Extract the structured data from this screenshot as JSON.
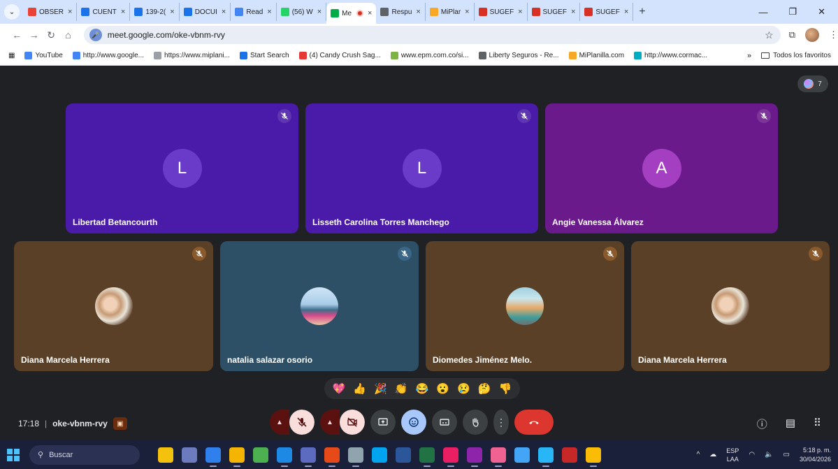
{
  "browser": {
    "tabs": [
      {
        "label": "OBSER",
        "favicon_color": "#ea4335"
      },
      {
        "label": "CUENT",
        "favicon_color": "#1a73e8"
      },
      {
        "label": "139-2(",
        "favicon_color": "#1a73e8"
      },
      {
        "label": "DOCUI",
        "favicon_color": "#1a73e8"
      },
      {
        "label": "Read",
        "favicon_color": "#4285f4"
      },
      {
        "label": "(56) W",
        "favicon_color": "#25d366"
      },
      {
        "label": "Me",
        "favicon_color": "#00ac47",
        "active": true
      },
      {
        "label": "Respu",
        "favicon_color": "#5f6368"
      },
      {
        "label": "MiPlar",
        "favicon_color": "#f9a825"
      },
      {
        "label": "SUGEF",
        "favicon_color": "#d93025"
      },
      {
        "label": "SUGEF",
        "favicon_color": "#d93025"
      },
      {
        "label": "SUGEF",
        "favicon_color": "#d93025"
      }
    ],
    "new_tab": "+",
    "close_glyph": "×",
    "url": "meet.google.com/oke-vbnm-rvy",
    "bookmarks": [
      {
        "label": "YouTube",
        "favicon_color": "#4285f4"
      },
      {
        "label": "http://www.google...",
        "favicon_color": "#4285f4"
      },
      {
        "label": "https://www.miplani...",
        "favicon_color": "#9aa0a6"
      },
      {
        "label": "Start Search",
        "favicon_color": "#1a73e8"
      },
      {
        "label": "(4) Candy Crush Sag...",
        "favicon_color": "#e53935"
      },
      {
        "label": "www.epm.com.co/si...",
        "favicon_color": "#7cb342"
      },
      {
        "label": "Liberty Seguros - Re...",
        "favicon_color": "#5f6368"
      },
      {
        "label": "MiPlanilla.com",
        "favicon_color": "#f9a825"
      },
      {
        "label": "http://www.cormac...",
        "favicon_color": "#00acc1"
      }
    ],
    "more_bookmarks": "»",
    "all_bookmarks": "Todos los favoritos"
  },
  "meet": {
    "participant_count": "7",
    "tiles": [
      {
        "name": "Libertad Betancourth",
        "initial": "L",
        "style": "t-purple"
      },
      {
        "name": "Lisseth Carolina Torres Manchego",
        "initial": "L",
        "style": "t-purple"
      },
      {
        "name": "Angie Vanessa Álvarez",
        "initial": "A",
        "style": "t-magenta"
      },
      {
        "name": "Diana Marcela Herrera",
        "style": "t-brown",
        "photo": "family"
      },
      {
        "name": "natalia salazar osorio",
        "style": "t-blue",
        "photo": "beach"
      },
      {
        "name": "Diomedes Jiménez Melo.",
        "style": "t-brown",
        "photo": "building"
      },
      {
        "name": "Diana Marcela Herrera",
        "style": "t-brown",
        "photo": "family"
      }
    ],
    "reactions": [
      "💖",
      "👍",
      "🎉",
      "👏",
      "😂",
      "😮",
      "😢",
      "🤔",
      "👎"
    ],
    "time": "17:18",
    "meeting_code": "oke-vbnm-rvy"
  },
  "taskbar": {
    "search_placeholder": "Buscar",
    "lang_top": "ESP",
    "lang_bottom": "LAA",
    "time": "5:18 p. m.",
    "date": "30/04/2026",
    "apps": [
      "#f4c20d",
      "#6c7bbd",
      "#2f80ed",
      "#f4b400",
      "#4caf50",
      "#1e88e5",
      "#5c6bc0",
      "#e64a19",
      "#90a4ae",
      "#00a4ef",
      "#2b579a",
      "#217346",
      "#e91e63",
      "#8e24aa",
      "#f06292",
      "#42a5f5",
      "#29b6f6",
      "#c62828",
      "#fbbc05"
    ]
  }
}
